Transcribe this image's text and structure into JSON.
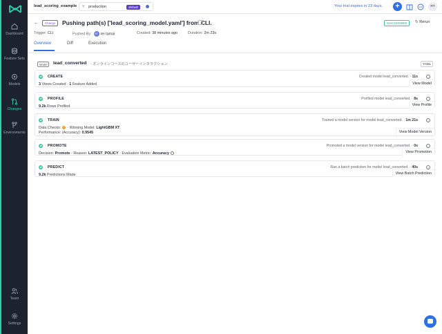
{
  "sidebar": {
    "items": [
      {
        "label": "Dashboard",
        "icon": "home-icon"
      },
      {
        "label": "Feature Sets",
        "icon": "database-icon"
      },
      {
        "label": "Models",
        "icon": "models-icon"
      },
      {
        "label": "Changes",
        "icon": "git-branch-icon",
        "active": true
      },
      {
        "label": "Environments",
        "icon": "environments-icon"
      },
      {
        "label": "Team",
        "icon": "team-icon"
      },
      {
        "label": "Settings",
        "icon": "gear-icon"
      }
    ]
  },
  "header": {
    "project": "lead_scoring_example",
    "branch": "production",
    "branch_badge": "default",
    "trial": "Your trial expires in 23 days.",
    "avatar": "RT"
  },
  "change": {
    "tag": "Change",
    "title": "Pushing path(s) ['lead_scoring_model.yaml'] from CLI.",
    "status": "SUCCEEDED",
    "rerun": "Rerun",
    "trigger_label": "Trigger:",
    "trigger": "CLI",
    "pushed_by_label": "Pushed By:",
    "pushed_by_avatar": "RT",
    "pushed_by": "rei tamai",
    "created_label": "Created:",
    "created": "38 minutes ago",
    "duration_label": "Duration:",
    "duration": "2m 23s"
  },
  "tabs": [
    "Overview",
    "Diff",
    "Execution"
  ],
  "model": {
    "tag": "Model",
    "name": "lead_converted",
    "desc": "- オンラインコースのユーザーインタラクション",
    "yaml": "YAML"
  },
  "steps": [
    {
      "name": "CREATE",
      "right": "Created model lead_converted.",
      "time": "11s",
      "line1": {
        "n1": "3",
        "t1": "Views Created",
        "n2": "1",
        "t2": "Feature Added"
      },
      "action": "View Model"
    },
    {
      "name": "PROFILE",
      "right": "Profiled model lead_converted.",
      "time": "8s",
      "line1": {
        "n1": "9.2k",
        "t1": "Rows Profiled"
      },
      "action": "View Profile"
    },
    {
      "name": "TRAIN",
      "right": "Trained a model version for model lead_converted.",
      "time": "1m 21s",
      "line1": {
        "l1": "Data Checks:",
        "l2": "Winning Model:",
        "v2": "LightGBM XT"
      },
      "line2": {
        "l1": "Performance: (Accuracy):",
        "v1": "0.9545"
      },
      "action": "View Model Version"
    },
    {
      "name": "PROMOTE",
      "right": "Promoted a model version for model lead_converted.",
      "time": "0s",
      "line1": {
        "l1": "Decision:",
        "v1": "Promote",
        "l2": "Reason:",
        "v2": "LATEST_POLICY",
        "l3": "Evaluation Metric:",
        "v3": "Accuracy"
      },
      "action": "View Promotion"
    },
    {
      "name": "PREDICT",
      "right": "Ran a batch prediction for model lead_converted.",
      "time": "40s",
      "line1": {
        "n1": "9.2k",
        "t1": "Predictions Made"
      },
      "action": "View Batch Prediction"
    }
  ]
}
